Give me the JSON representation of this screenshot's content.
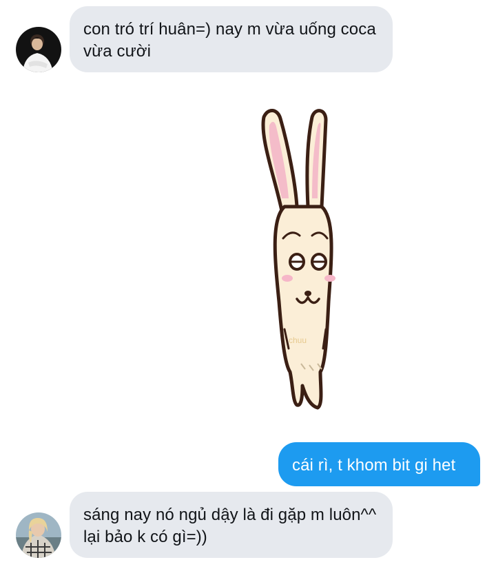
{
  "messages": [
    {
      "direction": "incoming",
      "avatar": "man-in-white-shirt-avatar",
      "text": "con tró trí huân=) nay m vừa uống coca vừa cười"
    },
    {
      "direction": "incoming",
      "type": "sticker",
      "sticker_text": "chuu"
    },
    {
      "direction": "outgoing",
      "text": "cái rì, t khom bit gi het"
    },
    {
      "direction": "incoming",
      "avatar": "blonde-person-avatar",
      "text": "sáng nay nó ngủ dậy là đi gặp m luôn^^ lại bảo k có gì=))"
    }
  ],
  "colors": {
    "incoming_bubble": "#e6e9ee",
    "outgoing_bubble": "#1d9bf0",
    "background": "#ffffff"
  }
}
